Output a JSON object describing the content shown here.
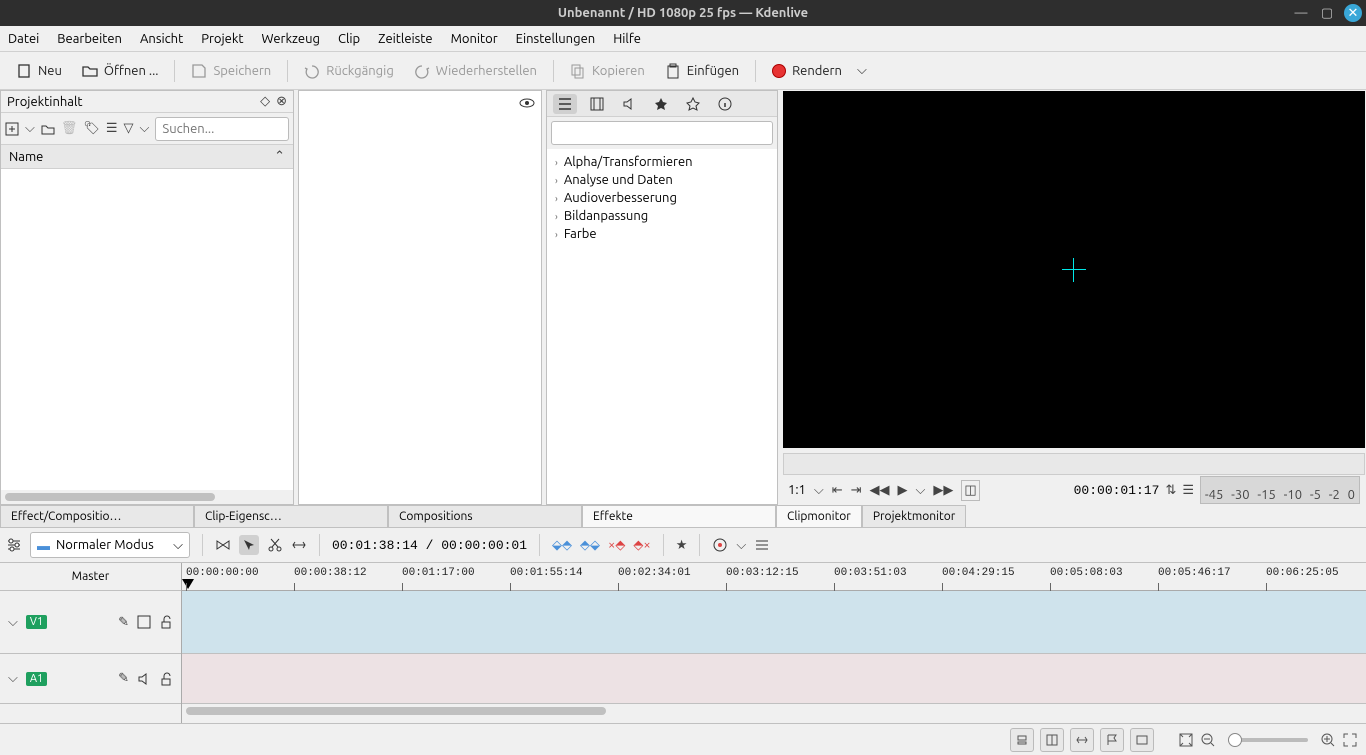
{
  "window": {
    "title": "Unbenannt / HD 1080p 25 fps — Kdenlive"
  },
  "menu": [
    "Datei",
    "Bearbeiten",
    "Ansicht",
    "Projekt",
    "Werkzeug",
    "Clip",
    "Zeitleiste",
    "Monitor",
    "Einstellungen",
    "Hilfe"
  ],
  "toolbar": {
    "new": "Neu",
    "open": "Öffnen ...",
    "save": "Speichern",
    "undo": "Rückgängig",
    "redo": "Wiederherstellen",
    "copy": "Kopieren",
    "paste": "Einfügen",
    "render": "Rendern"
  },
  "bin": {
    "title": "Projektinhalt",
    "search_placeholder": "Suchen...",
    "col_name": "Name"
  },
  "effects": {
    "items": [
      "Alpha/Transformieren",
      "Analyse und Daten",
      "Audioverbesserung",
      "Bildanpassung",
      "Farbe"
    ]
  },
  "mid_tabs_left": [
    "Effect/Compositio…",
    "Clip-Eigensc…",
    "Compositions",
    "Effekte"
  ],
  "mid_tabs_right": [
    "Clipmonitor",
    "Projektmonitor"
  ],
  "monitor": {
    "scale": "1:1",
    "timecode": "00:00:01:17",
    "vu_ticks": [
      "-45",
      "-30",
      "-15",
      "-10",
      "-5",
      "-2",
      "0"
    ]
  },
  "timeline_toolbar": {
    "mode": "Normaler Modus",
    "timecode": "00:01:38:14 / 00:00:00:01"
  },
  "timeline": {
    "master": "Master",
    "v1": "V1",
    "a1": "A1",
    "ticks": [
      "00:00:00:00",
      "00:00:38:12",
      "00:01:17:00",
      "00:01:55:14",
      "00:02:34:01",
      "00:03:12:15",
      "00:03:51:03",
      "00:04:29:15",
      "00:05:08:03",
      "00:05:46:17",
      "00:06:25:05"
    ]
  }
}
